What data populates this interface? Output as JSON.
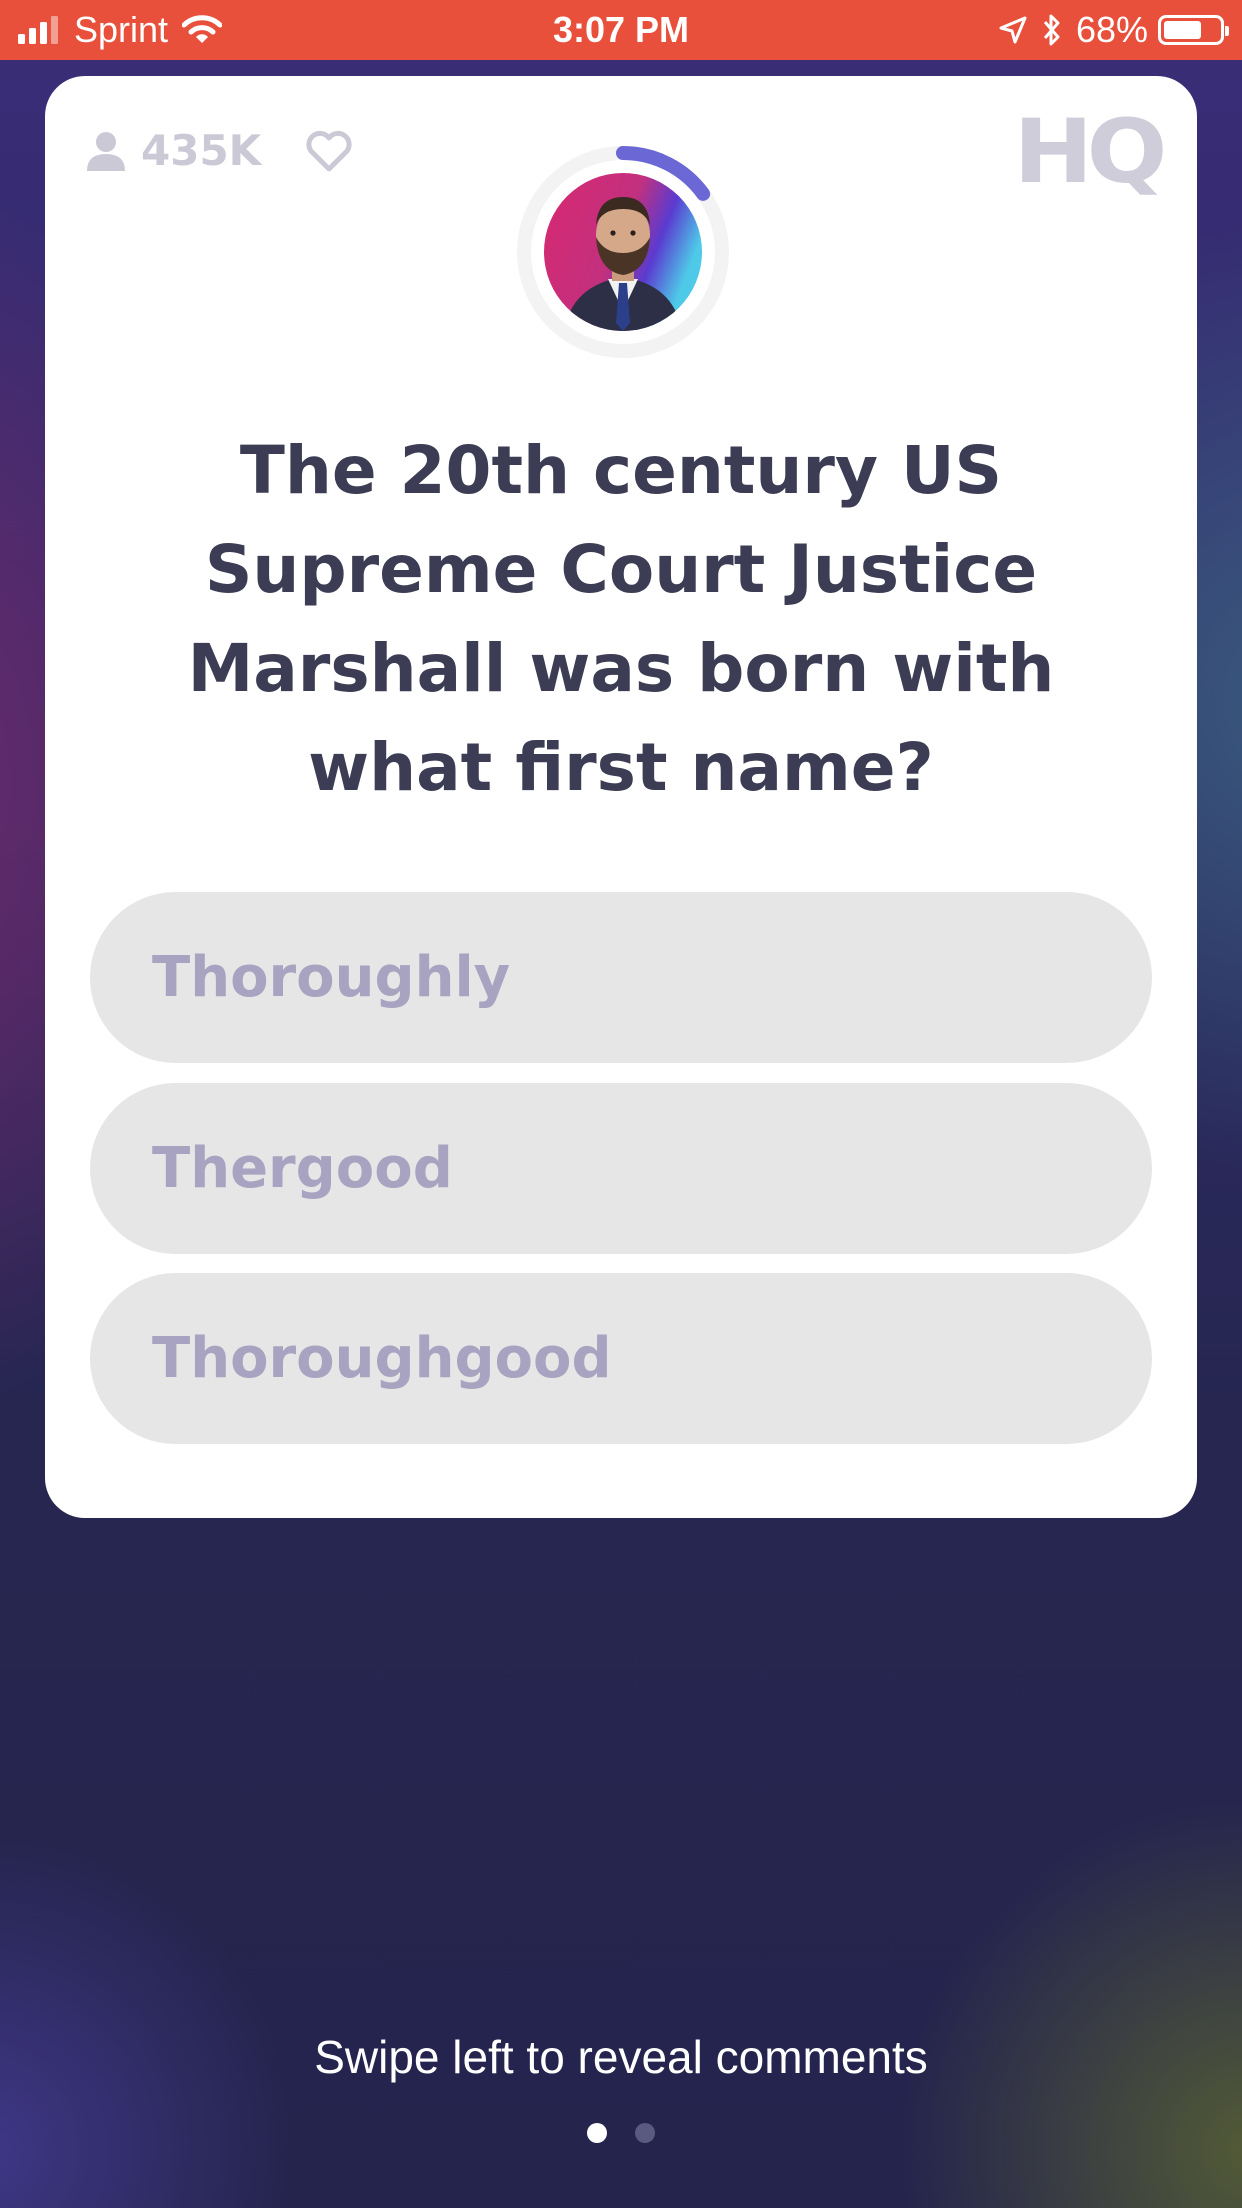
{
  "status_bar": {
    "carrier": "Sprint",
    "time": "3:07 PM",
    "battery": "68%",
    "battery_level": 0.68,
    "background_color": "#e8503c"
  },
  "header": {
    "viewer_count": "435K",
    "viewer_icon": "person-icon",
    "like_icon": "heart-icon",
    "logo": "HQ",
    "timer_progress": 0.15,
    "timer_color": "#6b68d6"
  },
  "question": {
    "text": "The 20th century US Supreme Court Justice Marshall was born with what first name?"
  },
  "answers": [
    {
      "label": "Thoroughly"
    },
    {
      "label": "Thergood"
    },
    {
      "label": "Thoroughgood"
    }
  ],
  "footer": {
    "hint": "Swipe left to reveal comments",
    "page_count": 2,
    "active_page": 1
  }
}
